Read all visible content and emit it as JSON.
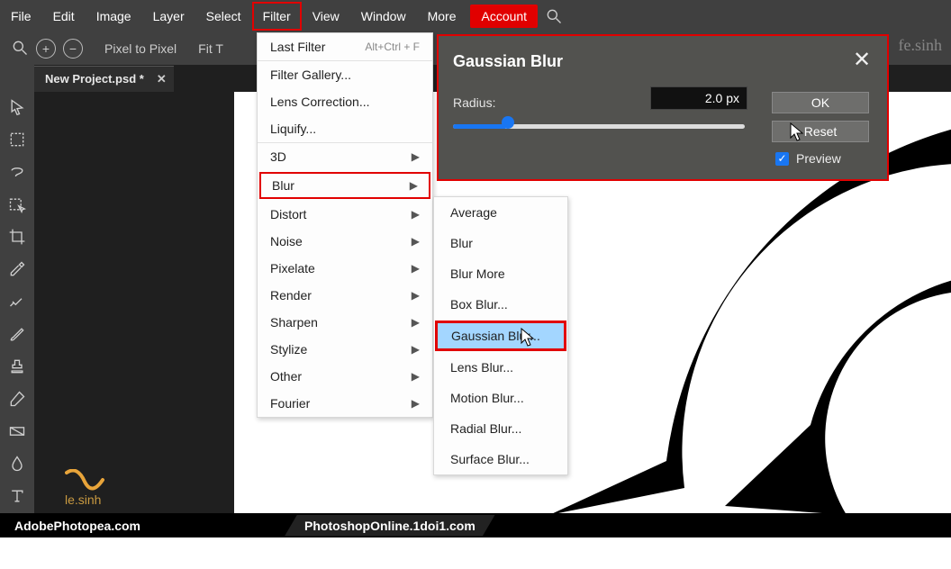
{
  "menubar": {
    "file": "File",
    "edit": "Edit",
    "image": "Image",
    "layer": "Layer",
    "select": "Select",
    "filter": "Filter",
    "view": "View",
    "window": "Window",
    "more": "More",
    "account": "Account"
  },
  "toolbar2": {
    "pixel": "Pixel to Pixel",
    "fit": "Fit T"
  },
  "tab": {
    "name": "New Project.psd *"
  },
  "filterMenu": {
    "last": "Last Filter",
    "last_shortcut": "Alt+Ctrl + F",
    "gallery": "Filter Gallery...",
    "lens": "Lens Correction...",
    "liquify": "Liquify...",
    "threeD": "3D",
    "blur": "Blur",
    "distort": "Distort",
    "noise": "Noise",
    "pixelate": "Pixelate",
    "render": "Render",
    "sharpen": "Sharpen",
    "stylize": "Stylize",
    "other": "Other",
    "fourier": "Fourier"
  },
  "blurSub": {
    "average": "Average",
    "blur": "Blur",
    "more": "Blur More",
    "box": "Box Blur...",
    "gaussian": "Gaussian Blur...",
    "lens": "Lens Blur...",
    "motion": "Motion Blur...",
    "radial": "Radial Blur...",
    "surface": "Surface Blur..."
  },
  "dialog": {
    "title": "Gaussian Blur",
    "radius_label": "Radius:",
    "radius_value": "2.0 px",
    "ok": "OK",
    "reset": "Reset",
    "preview": "Preview"
  },
  "footer": {
    "left": "AdobePhotopea.com",
    "center": "PhotoshopOnline.1doi1.com"
  },
  "watermark": {
    "text": "fe.sinh"
  },
  "watermark2": {
    "text": "le.sinh"
  }
}
